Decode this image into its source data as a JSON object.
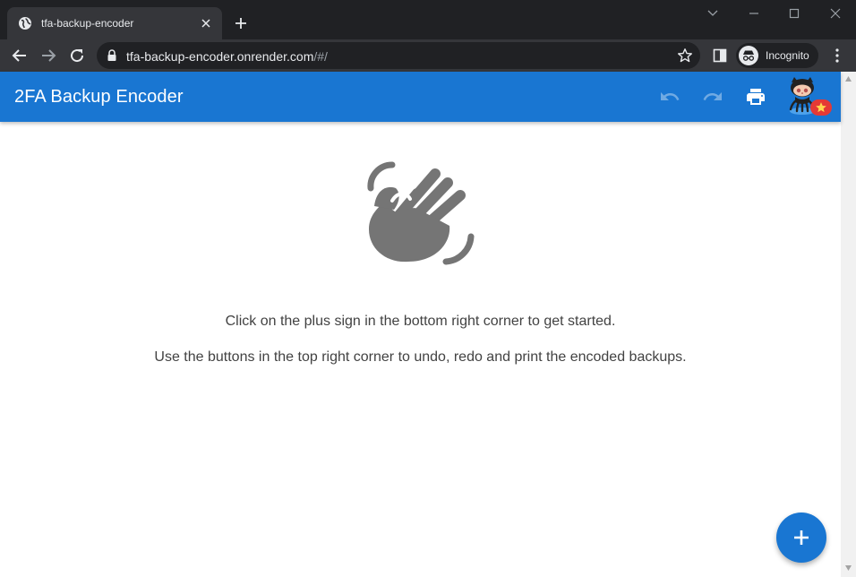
{
  "browser": {
    "tab": {
      "title": "tfa-backup-encoder",
      "favicon": "globe-icon"
    },
    "address": {
      "host": "tfa-backup-encoder.onrender.com",
      "path": "/#/"
    },
    "profile_label": "Incognito"
  },
  "app": {
    "title": "2FA Backup Encoder",
    "toolbar": [
      "undo-icon",
      "redo-icon",
      "print-icon",
      "github-octocat-icon"
    ],
    "empty_state": {
      "icon": "waving-hand-icon",
      "line1": "Click on the plus sign in the bottom right corner to get started.",
      "line2": "Use the buttons in the top right corner to undo, redo and print the encoded backups."
    },
    "fab_icon": "add-icon"
  },
  "colors": {
    "primary": "#1976d2",
    "chrome_dark": "#202124",
    "chrome_tab": "#35363a",
    "icon_gray": "#757575",
    "badge_red": "#e53935"
  }
}
